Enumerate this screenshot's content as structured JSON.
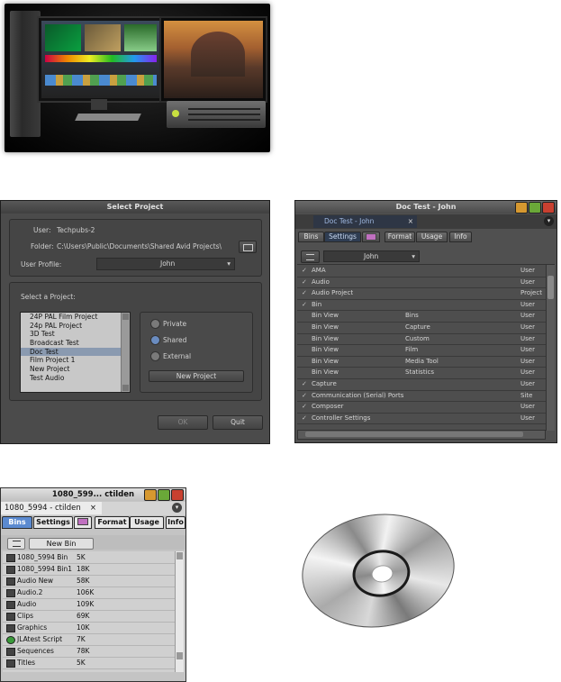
{
  "select_project": {
    "title": "Select Project",
    "user_label": "User:",
    "user_value": "Techpubs-2",
    "folder_label": "Folder:",
    "folder_value": "C:\\Users\\Public\\Documents\\Shared Avid Projects\\",
    "user_profile_label": "User Profile:",
    "user_profile_value": "John",
    "select_label": "Select a Project:",
    "projects": [
      "24P PAL Film Project",
      "24p PAL Project",
      "3D Test",
      "Broadcast Test",
      "Doc Test",
      "Film Project 1",
      "New Project",
      "Test Audio"
    ],
    "selected_index": 4,
    "radio_private": "Private",
    "radio_shared": "Shared",
    "radio_external": "External",
    "new_project_button": "New Project",
    "ok_button": "OK",
    "quit_button": "Quit"
  },
  "doc_test": {
    "title": "Doc Test - John",
    "tab_title": "Doc Test - John",
    "tabs": [
      "Bins",
      "Settings",
      "Format",
      "Usage",
      "Info"
    ],
    "profile": "John",
    "rows": [
      {
        "check": "✓",
        "name": "AMA",
        "sub": "",
        "scope": "User"
      },
      {
        "check": "✓",
        "name": "Audio",
        "sub": "",
        "scope": "User"
      },
      {
        "check": "✓",
        "name": "Audio Project",
        "sub": "",
        "scope": "Project"
      },
      {
        "check": "✓",
        "name": "Bin",
        "sub": "",
        "scope": "User"
      },
      {
        "check": "",
        "name": "Bin View",
        "sub": "Bins",
        "scope": "User"
      },
      {
        "check": "",
        "name": "Bin View",
        "sub": "Capture",
        "scope": "User"
      },
      {
        "check": "",
        "name": "Bin View",
        "sub": "Custom",
        "scope": "User"
      },
      {
        "check": "",
        "name": "Bin View",
        "sub": "Film",
        "scope": "User"
      },
      {
        "check": "",
        "name": "Bin View",
        "sub": "Media Tool",
        "scope": "User"
      },
      {
        "check": "",
        "name": "Bin View",
        "sub": "Statistics",
        "scope": "User"
      },
      {
        "check": "✓",
        "name": "Capture",
        "sub": "",
        "scope": "User"
      },
      {
        "check": "✓",
        "name": "Communication (Serial) Ports",
        "sub": "",
        "scope": "Site"
      },
      {
        "check": "✓",
        "name": "Composer",
        "sub": "",
        "scope": "User"
      },
      {
        "check": "✓",
        "name": "Controller Settings",
        "sub": "",
        "scope": "User"
      }
    ]
  },
  "bins_window": {
    "title": "1080_599... ctilden",
    "tab_title": "1080_5994 - ctilden",
    "tabs": [
      "Bins",
      "Settings",
      "Format",
      "Usage",
      "Info"
    ],
    "new_bin_button": "New Bin",
    "rows": [
      {
        "name": "1080_5994 Bin",
        "size": "5K"
      },
      {
        "name": "1080_5994 Bin1",
        "size": "18K"
      },
      {
        "name": "Audio New",
        "size": "58K"
      },
      {
        "name": "Audio.2",
        "size": "106K"
      },
      {
        "name": "Audio",
        "size": "109K"
      },
      {
        "name": "Clips",
        "size": "69K"
      },
      {
        "name": "Graphics",
        "size": "10K"
      },
      {
        "name": "JLAtest Script",
        "size": "7K"
      },
      {
        "name": "Sequences",
        "size": "78K"
      },
      {
        "name": "Titles",
        "size": "5K"
      }
    ]
  }
}
